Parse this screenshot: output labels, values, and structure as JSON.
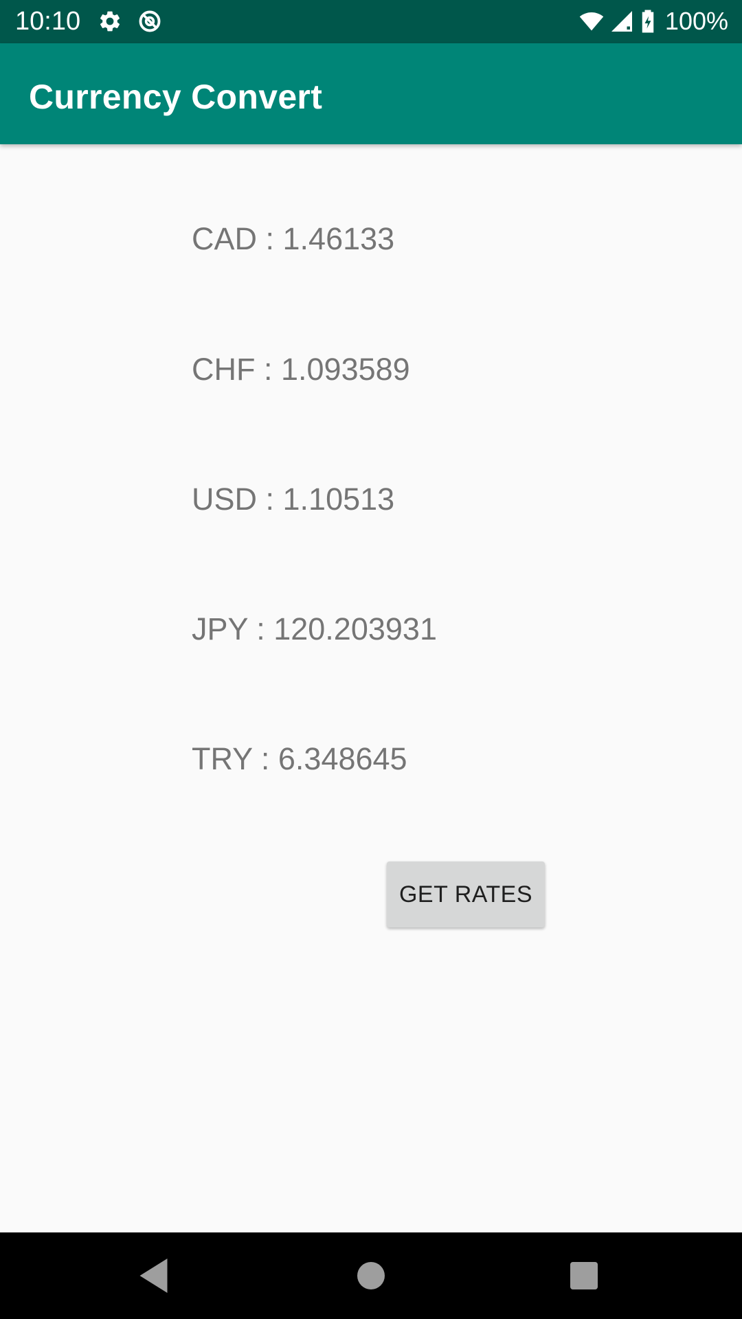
{
  "status_bar": {
    "time": "10:10",
    "battery_percent": "100%",
    "background": "#00574b"
  },
  "app_bar": {
    "title": "Currency Convert",
    "background": "#008577"
  },
  "rates": [
    {
      "text": "CAD : 1.46133"
    },
    {
      "text": "CHF : 1.093589"
    },
    {
      "text": "USD : 1.10513"
    },
    {
      "text": "JPY : 120.203931"
    },
    {
      "text": "TRY : 6.348645"
    }
  ],
  "get_rates_button": {
    "label": "GET RATES"
  },
  "icons": {
    "status_left": [
      "gear-icon",
      "no-disturb-icon"
    ],
    "status_right": [
      "wifi-icon",
      "cell-signal-icon",
      "battery-charging-icon"
    ],
    "nav": [
      "back-icon",
      "home-icon",
      "recents-icon"
    ]
  }
}
